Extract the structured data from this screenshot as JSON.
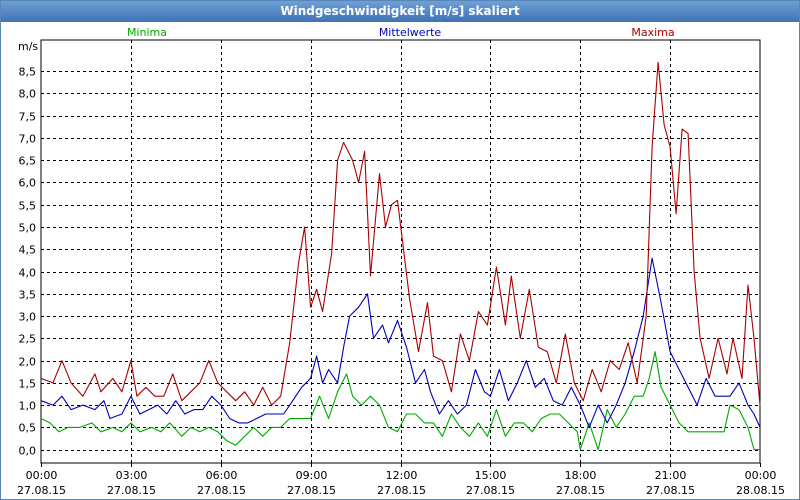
{
  "window": {
    "title": "Windgeschwindigkeit [m/s] skaliert"
  },
  "chart_data": {
    "type": "line",
    "ylabel": "m/s",
    "ylim": [
      -0.3,
      9.2
    ],
    "yticks": [
      0,
      0.5,
      1,
      1.5,
      2,
      2.5,
      3,
      3.5,
      4,
      4.5,
      5,
      5.5,
      6,
      6.5,
      7,
      7.5,
      8,
      8.5
    ],
    "ytick_labels": [
      "0,0",
      "0,5",
      "1,0",
      "1,5",
      "2,0",
      "2,5",
      "3,0",
      "3,5",
      "4,0",
      "4,5",
      "5,0",
      "5,5",
      "6,0",
      "6,5",
      "7,0",
      "7,5",
      "8,0",
      "8,5"
    ],
    "xlim": [
      0,
      24
    ],
    "xticks": [
      0,
      3,
      6,
      9,
      12,
      15,
      18,
      21,
      24
    ],
    "xtick_labels": [
      {
        "time": "00:00",
        "date": "27.08.15"
      },
      {
        "time": "03:00",
        "date": "27.08.15"
      },
      {
        "time": "06:00",
        "date": "27.08.15"
      },
      {
        "time": "09:00",
        "date": "27.08.15"
      },
      {
        "time": "12:00",
        "date": "27.08.15"
      },
      {
        "time": "15:00",
        "date": "27.08.15"
      },
      {
        "time": "18:00",
        "date": "27.08.15"
      },
      {
        "time": "21:00",
        "date": "27.08.15"
      },
      {
        "time": "00:00",
        "date": "28.08.15"
      }
    ],
    "grid": true,
    "legend_placement": "top",
    "series": [
      {
        "name": "Minima",
        "color": "#00aa00",
        "points": [
          [
            0,
            0.7
          ],
          [
            0.3,
            0.6
          ],
          [
            0.6,
            0.4
          ],
          [
            0.9,
            0.5
          ],
          [
            1.3,
            0.5
          ],
          [
            1.7,
            0.6
          ],
          [
            2,
            0.4
          ],
          [
            2.4,
            0.5
          ],
          [
            2.7,
            0.4
          ],
          [
            3.0,
            0.6
          ],
          [
            3.3,
            0.4
          ],
          [
            3.7,
            0.5
          ],
          [
            4.0,
            0.4
          ],
          [
            4.3,
            0.6
          ],
          [
            4.7,
            0.3
          ],
          [
            5.0,
            0.5
          ],
          [
            5.3,
            0.4
          ],
          [
            5.6,
            0.5
          ],
          [
            5.9,
            0.4
          ],
          [
            6.2,
            0.2
          ],
          [
            6.5,
            0.1
          ],
          [
            6.8,
            0.3
          ],
          [
            7.1,
            0.5
          ],
          [
            7.4,
            0.3
          ],
          [
            7.7,
            0.5
          ],
          [
            8.0,
            0.5
          ],
          [
            8.3,
            0.7
          ],
          [
            8.6,
            0.7
          ],
          [
            9.0,
            0.7
          ],
          [
            9.3,
            1.2
          ],
          [
            9.6,
            0.7
          ],
          [
            9.9,
            1.3
          ],
          [
            10.2,
            1.7
          ],
          [
            10.4,
            1.2
          ],
          [
            10.7,
            1.0
          ],
          [
            11.0,
            1.2
          ],
          [
            11.3,
            1.0
          ],
          [
            11.6,
            0.5
          ],
          [
            11.9,
            0.4
          ],
          [
            12.2,
            0.8
          ],
          [
            12.5,
            0.8
          ],
          [
            12.8,
            0.6
          ],
          [
            13.1,
            0.6
          ],
          [
            13.4,
            0.3
          ],
          [
            13.7,
            0.8
          ],
          [
            14.0,
            0.5
          ],
          [
            14.3,
            0.3
          ],
          [
            14.6,
            0.6
          ],
          [
            14.9,
            0.3
          ],
          [
            15.2,
            0.9
          ],
          [
            15.5,
            0.3
          ],
          [
            15.8,
            0.6
          ],
          [
            16.1,
            0.6
          ],
          [
            16.4,
            0.4
          ],
          [
            16.7,
            0.7
          ],
          [
            17.0,
            0.8
          ],
          [
            17.3,
            0.8
          ],
          [
            17.6,
            0.6
          ],
          [
            17.9,
            0.4
          ],
          [
            18.0,
            0.0
          ],
          [
            18.3,
            0.6
          ],
          [
            18.6,
            0.0
          ],
          [
            18.9,
            0.9
          ],
          [
            19.2,
            0.5
          ],
          [
            19.5,
            0.8
          ],
          [
            19.8,
            1.2
          ],
          [
            20.1,
            1.2
          ],
          [
            20.3,
            1.6
          ],
          [
            20.5,
            2.2
          ],
          [
            20.7,
            1.4
          ],
          [
            21.0,
            1.0
          ],
          [
            21.3,
            0.6
          ],
          [
            21.6,
            0.4
          ],
          [
            21.9,
            0.4
          ],
          [
            22.2,
            0.4
          ],
          [
            22.5,
            0.4
          ],
          [
            22.8,
            0.4
          ],
          [
            23.0,
            1.0
          ],
          [
            23.3,
            0.9
          ],
          [
            23.6,
            0.5
          ],
          [
            23.8,
            0.0
          ],
          [
            24.0,
            0.0
          ]
        ]
      },
      {
        "name": "Mittelwerte",
        "color": "#0000bb",
        "points": [
          [
            0,
            1.1
          ],
          [
            0.4,
            1.0
          ],
          [
            0.7,
            1.2
          ],
          [
            1.0,
            0.9
          ],
          [
            1.4,
            1.0
          ],
          [
            1.8,
            0.9
          ],
          [
            2.1,
            1.1
          ],
          [
            2.3,
            0.7
          ],
          [
            2.7,
            0.8
          ],
          [
            3.0,
            1.2
          ],
          [
            3.3,
            0.8
          ],
          [
            3.6,
            0.9
          ],
          [
            3.9,
            1.0
          ],
          [
            4.2,
            0.8
          ],
          [
            4.5,
            1.1
          ],
          [
            4.8,
            0.8
          ],
          [
            5.1,
            0.9
          ],
          [
            5.4,
            0.9
          ],
          [
            5.7,
            1.2
          ],
          [
            6.0,
            1.0
          ],
          [
            6.3,
            0.7
          ],
          [
            6.6,
            0.6
          ],
          [
            6.9,
            0.6
          ],
          [
            7.2,
            0.7
          ],
          [
            7.5,
            0.8
          ],
          [
            7.8,
            0.8
          ],
          [
            8.1,
            0.8
          ],
          [
            8.4,
            1.1
          ],
          [
            8.7,
            1.4
          ],
          [
            9.0,
            1.6
          ],
          [
            9.2,
            2.1
          ],
          [
            9.4,
            1.5
          ],
          [
            9.6,
            1.8
          ],
          [
            9.9,
            1.5
          ],
          [
            10.1,
            2.3
          ],
          [
            10.3,
            3.0
          ],
          [
            10.6,
            3.2
          ],
          [
            10.9,
            3.5
          ],
          [
            11.1,
            2.5
          ],
          [
            11.4,
            2.8
          ],
          [
            11.6,
            2.4
          ],
          [
            11.9,
            2.9
          ],
          [
            12.2,
            2.3
          ],
          [
            12.5,
            1.5
          ],
          [
            12.8,
            1.8
          ],
          [
            13.0,
            1.3
          ],
          [
            13.3,
            0.8
          ],
          [
            13.6,
            1.1
          ],
          [
            13.9,
            0.8
          ],
          [
            14.2,
            1.0
          ],
          [
            14.5,
            1.8
          ],
          [
            14.8,
            1.3
          ],
          [
            15.0,
            1.2
          ],
          [
            15.3,
            1.8
          ],
          [
            15.6,
            1.1
          ],
          [
            15.9,
            1.5
          ],
          [
            16.2,
            2.0
          ],
          [
            16.5,
            1.4
          ],
          [
            16.8,
            1.6
          ],
          [
            17.1,
            1.1
          ],
          [
            17.4,
            1.0
          ],
          [
            17.7,
            1.4
          ],
          [
            18.0,
            1.0
          ],
          [
            18.3,
            0.5
          ],
          [
            18.6,
            1.0
          ],
          [
            18.9,
            0.6
          ],
          [
            19.2,
            1.0
          ],
          [
            19.5,
            1.5
          ],
          [
            19.8,
            2.2
          ],
          [
            20.1,
            3.0
          ],
          [
            20.4,
            4.3
          ],
          [
            20.7,
            3.3
          ],
          [
            21.0,
            2.2
          ],
          [
            21.3,
            1.8
          ],
          [
            21.6,
            1.4
          ],
          [
            21.9,
            1.0
          ],
          [
            22.2,
            1.6
          ],
          [
            22.5,
            1.2
          ],
          [
            22.8,
            1.2
          ],
          [
            23.0,
            1.2
          ],
          [
            23.3,
            1.5
          ],
          [
            23.6,
            1.0
          ],
          [
            23.8,
            0.8
          ],
          [
            24.0,
            0.5
          ]
        ]
      },
      {
        "name": "Maxima",
        "color": "#aa0000",
        "points": [
          [
            0,
            1.6
          ],
          [
            0.4,
            1.5
          ],
          [
            0.7,
            2.0
          ],
          [
            1.0,
            1.5
          ],
          [
            1.4,
            1.2
          ],
          [
            1.8,
            1.7
          ],
          [
            2.0,
            1.3
          ],
          [
            2.4,
            1.6
          ],
          [
            2.7,
            1.3
          ],
          [
            3.0,
            2.0
          ],
          [
            3.2,
            1.2
          ],
          [
            3.5,
            1.4
          ],
          [
            3.8,
            1.2
          ],
          [
            4.1,
            1.2
          ],
          [
            4.4,
            1.7
          ],
          [
            4.7,
            1.1
          ],
          [
            5.0,
            1.3
          ],
          [
            5.3,
            1.5
          ],
          [
            5.6,
            2.0
          ],
          [
            5.9,
            1.5
          ],
          [
            6.2,
            1.3
          ],
          [
            6.5,
            1.1
          ],
          [
            6.8,
            1.3
          ],
          [
            7.1,
            1.0
          ],
          [
            7.4,
            1.4
          ],
          [
            7.7,
            1.0
          ],
          [
            8.0,
            1.2
          ],
          [
            8.3,
            2.4
          ],
          [
            8.6,
            4.2
          ],
          [
            8.8,
            5.0
          ],
          [
            9.0,
            3.2
          ],
          [
            9.2,
            3.6
          ],
          [
            9.4,
            3.1
          ],
          [
            9.7,
            4.4
          ],
          [
            9.9,
            6.5
          ],
          [
            10.1,
            6.9
          ],
          [
            10.4,
            6.5
          ],
          [
            10.6,
            6.0
          ],
          [
            10.8,
            6.7
          ],
          [
            11.0,
            3.9
          ],
          [
            11.3,
            6.2
          ],
          [
            11.5,
            5.0
          ],
          [
            11.7,
            5.5
          ],
          [
            11.9,
            5.6
          ],
          [
            12.1,
            4.5
          ],
          [
            12.3,
            3.4
          ],
          [
            12.6,
            2.2
          ],
          [
            12.9,
            3.3
          ],
          [
            13.1,
            2.1
          ],
          [
            13.4,
            2.0
          ],
          [
            13.7,
            1.3
          ],
          [
            14.0,
            2.6
          ],
          [
            14.3,
            2.0
          ],
          [
            14.6,
            3.1
          ],
          [
            14.9,
            2.8
          ],
          [
            15.2,
            4.1
          ],
          [
            15.5,
            2.8
          ],
          [
            15.7,
            3.9
          ],
          [
            16.0,
            2.5
          ],
          [
            16.3,
            3.6
          ],
          [
            16.6,
            2.3
          ],
          [
            16.9,
            2.2
          ],
          [
            17.2,
            1.5
          ],
          [
            17.5,
            2.6
          ],
          [
            17.8,
            1.5
          ],
          [
            18.1,
            1.1
          ],
          [
            18.4,
            1.8
          ],
          [
            18.7,
            1.3
          ],
          [
            19.0,
            2.0
          ],
          [
            19.3,
            1.8
          ],
          [
            19.6,
            2.4
          ],
          [
            19.9,
            1.5
          ],
          [
            20.2,
            3.0
          ],
          [
            20.4,
            6.8
          ],
          [
            20.6,
            8.7
          ],
          [
            20.8,
            7.3
          ],
          [
            21.0,
            6.8
          ],
          [
            21.2,
            5.3
          ],
          [
            21.4,
            7.2
          ],
          [
            21.6,
            7.1
          ],
          [
            21.8,
            4.0
          ],
          [
            22.0,
            2.5
          ],
          [
            22.3,
            1.6
          ],
          [
            22.6,
            2.5
          ],
          [
            22.9,
            1.7
          ],
          [
            23.1,
            2.5
          ],
          [
            23.4,
            1.6
          ],
          [
            23.6,
            3.7
          ],
          [
            23.8,
            2.5
          ],
          [
            24.0,
            1.0
          ]
        ]
      }
    ]
  }
}
